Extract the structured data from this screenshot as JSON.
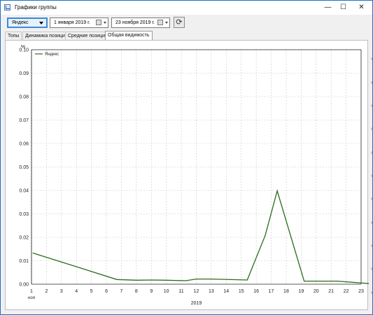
{
  "window": {
    "title": "Графики группы",
    "minimize_glyph": "—",
    "maximize_glyph": "☐",
    "close_glyph": "✕"
  },
  "toolbar": {
    "engine": "Яндекс",
    "date_from": "1  января  2019 г.",
    "date_to": "23  ноября  2019 г.",
    "refresh_icon": "refresh-icon"
  },
  "tabs": [
    {
      "label": "Топы",
      "active": false
    },
    {
      "label": "Динамика позиций",
      "active": false
    },
    {
      "label": "Средние позиции",
      "active": false
    },
    {
      "label": "Общая видимость",
      "active": true
    }
  ],
  "chart_data": {
    "type": "line",
    "ylabel": "%",
    "xlabel": "2019",
    "ylim": [
      0,
      0.1
    ],
    "yticks": [
      "0.00",
      "0.01",
      "0.02",
      "0.03",
      "0.04",
      "0.05",
      "0.06",
      "0.07",
      "0.08",
      "0.09",
      "0.10"
    ],
    "xticks": [
      "1",
      "2",
      "3",
      "4",
      "5",
      "6",
      "7",
      "8",
      "9",
      "10",
      "11",
      "12",
      "13",
      "14",
      "15",
      "16",
      "17",
      "18",
      "19",
      "20",
      "21",
      "22",
      "23"
    ],
    "x_sublabel": "ноя",
    "grid": true,
    "legend_position": "top-left",
    "color": "#2d6a1e",
    "series": [
      {
        "name": "Яндекс",
        "x": [
          0.1,
          5.7,
          7.0,
          8.0,
          9.0,
          10.3,
          11.0,
          12.0,
          14.4,
          15.6,
          16.4,
          18.2,
          19.4,
          20.4,
          22.9
        ],
        "y": [
          0.0133,
          0.002,
          0.0017,
          0.0018,
          0.0017,
          0.0015,
          0.0022,
          0.0022,
          0.0018,
          0.0208,
          0.0398,
          0.0013,
          0.0013,
          0.0013,
          0.0001
        ]
      }
    ]
  }
}
